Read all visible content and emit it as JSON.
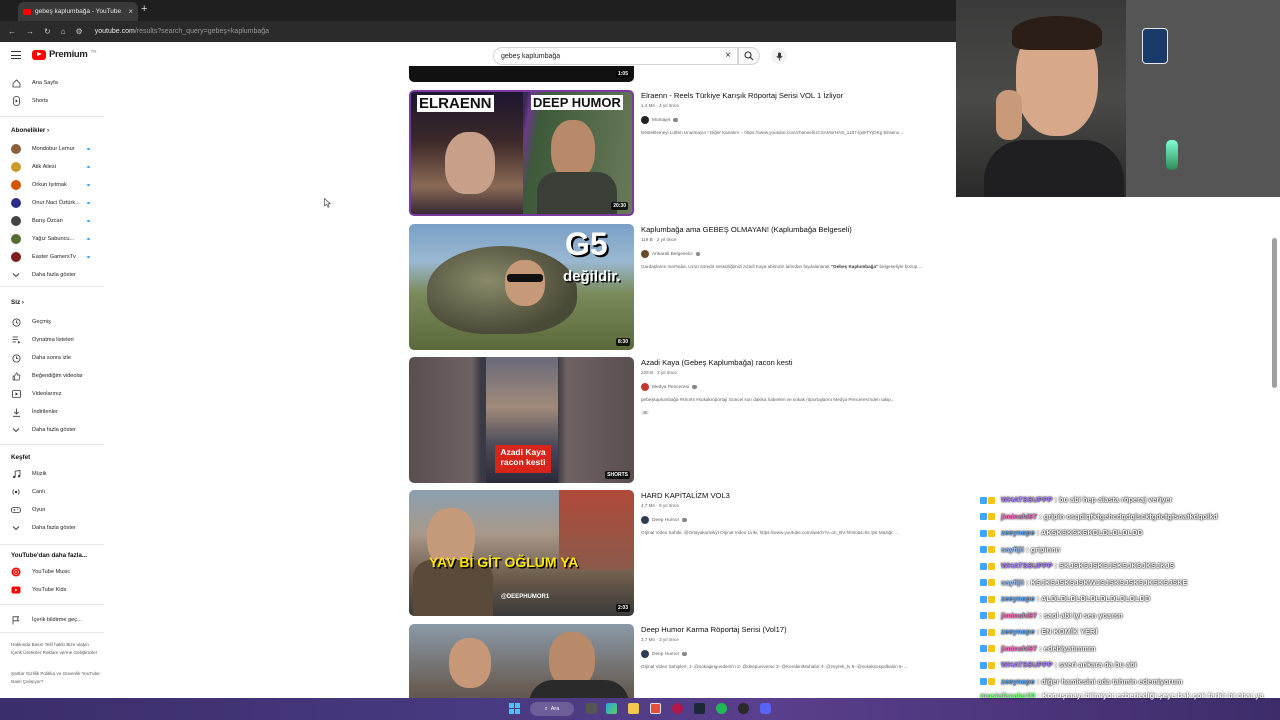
{
  "browser": {
    "tab_title": "gebeş kaplumbağa - YouTube",
    "url_host": "youtube.com",
    "url_path": "/results?search_query=gebeş+kaplumbağa"
  },
  "header": {
    "logo_text": "Premium",
    "logo_region": "TR",
    "search_value": "gebeş kaplumbağa"
  },
  "sidebar": {
    "main": [
      {
        "label": "Ana Sayfa",
        "icon": "home-icon"
      },
      {
        "label": "Shorts",
        "icon": "shorts-icon"
      }
    ],
    "subs_title": "Abonelikler",
    "subs": [
      {
        "label": "Mondobur Lemur",
        "color": "#8b5e3c"
      },
      {
        "label": "Atik Ailesi",
        "color": "#c89b2a"
      },
      {
        "label": "Orkun Işıtmak",
        "color": "#d35400"
      },
      {
        "label": "Onur Naci Öztürk...",
        "color": "#2c2c8a"
      },
      {
        "label": "Barış Özcan",
        "color": "#444444"
      },
      {
        "label": "Yağız Sabuncu...",
        "color": "#556b2f"
      },
      {
        "label": "Easter GamersTv",
        "color": "#7f1d1d"
      }
    ],
    "subs_more": "Daha fazla göster",
    "you_title": "Siz",
    "you": [
      {
        "label": "Geçmiş",
        "icon": "history-icon"
      },
      {
        "label": "Oynatma listeleri",
        "icon": "playlist-icon"
      },
      {
        "label": "Daha sonra izle",
        "icon": "watch-later-icon"
      },
      {
        "label": "Beğendiğim videolar",
        "icon": "like-icon"
      },
      {
        "label": "Videolarınız",
        "icon": "your-videos-icon"
      },
      {
        "label": "İndirilenler",
        "icon": "download-icon"
      },
      {
        "label": "Daha fazla göster",
        "icon": "chevron-down-icon"
      }
    ],
    "explore_title": "Keşfet",
    "explore": [
      {
        "label": "Müzik",
        "icon": "music-icon"
      },
      {
        "label": "Canlı",
        "icon": "live-icon"
      },
      {
        "label": "Oyun",
        "icon": "gaming-icon"
      },
      {
        "label": "Daha fazla göster",
        "icon": "chevron-down-icon"
      }
    ],
    "more_title": "YouTube'dan daha fazla...",
    "more": [
      {
        "label": "YouTube Music",
        "icon": "youtube-music-icon"
      },
      {
        "label": "YouTube Kids",
        "icon": "youtube-kids-icon"
      }
    ],
    "report": "İçerik bildirme geç...",
    "footer1": "Hakkında  Basın  Telif hakkı  Bize ulaşın  İçerik Üreticiler  Reklam verme  Geliştiriciler",
    "footer2": "Şartlar  Gizlilik  Politika ve Güvenlik  YouTube Nasıl Çalışıyor?"
  },
  "results": [
    {
      "title": "Elraenn - Reels Türkiye Karışık Röportaj Serisi VOL 1 İzliyor",
      "meta": "1,4 Mn · 4 yıl önce",
      "channel": "Montajet",
      "desc": "Desteklemeyi Lütfen Unutmayın ! Diğer Kanalım :- https://www.youtube.com/channel/UCSAMorHAS_1187-lgWTYjOKg Elraeno ...",
      "duration": "20:30",
      "thumb_left": "ELRAENN",
      "thumb_right": "DEEP HUMOR"
    },
    {
      "title": "Kaplumbağa ama GEBEŞ OLMAYAN! (Kaplumbağa Belgeseli)",
      "meta": "119 B · 2 yıl önce",
      "channel": "Ankarali Belgeselci",
      "desc_pre": "Gardaşlarım merhaba. Uzun süredir sessizliğimizi Azadi Kaya abimizin lafından faydalanarak ",
      "desc_bold": "\"Gebeş Kaplumbağa\"",
      "desc_post": " belgeseliyle bozup ...",
      "duration": "8:30",
      "thumb_big": "G5",
      "thumb_small": "değildir."
    },
    {
      "title": "Azadi Kaya (Gebeş Kaplumbağa) racon kesti",
      "meta": "228 B · 2 yıl önce",
      "channel": "Medya Penceresi",
      "desc": "gebeşkaplumbağa #shorts #sokakroportaji Güncel son dakika haberleri ve sokak röportajlarını Medya Penceresi'nden takip...",
      "badge": "4K",
      "duration": "SHORTS",
      "thumb_caption": "Azadi Kaya racon kesti"
    },
    {
      "title": "HARD KAPİTALİZM VOL3",
      "meta": "4,7 Mn · 5 yıl önce",
      "channel": "Deep Humor",
      "desc": "Orjinal Video Sahibi; @Ortayakarisikyt Orjinal Video Linki; https://www.youtube.com/watch?v=on_BV-hfmlo&t=5s Şiir Müziği; ...",
      "duration": "2:03",
      "thumb_caption": "YAV Bİ GİT OĞLUM YA",
      "thumb_handle": "@DEEPHUMOR1"
    },
    {
      "title": "Deep Humor Karma Röportaj Serisi (Vol17)",
      "meta": "3,7 Mn · 3 yıl önce",
      "channel": "Deep Humor",
      "desc": "Orjinal Video Sahipleri; 1- @sokagingundemi'n 2- @deepuniverse 3- @KerabiniMuhabir 4- @zeyrek_tv 5- @sokaksosyalbasin 6- ...",
      "duration": ""
    }
  ],
  "prev_duration": "1:05",
  "chat": [
    {
      "user": "WHATSSUPPP",
      "color": "#b084ff",
      "msg": "bu abi hep alasta röperaj veriyer"
    },
    {
      "user": "jiminshi97",
      "color": "#ff6ec7",
      "msg": "gripin osqdlqfkfgehcdqdqlsckfgdcfgfsoafkdqolkd"
    },
    {
      "user": "zeeynope",
      "color": "#5aa9ff",
      "msg": "AKSKSKSKSKDLDLDLDLDD"
    },
    {
      "user": "sayfijii",
      "color": "#a0c8ff",
      "msg": "gripinnn"
    },
    {
      "user": "WHATSSUPPP",
      "color": "#b084ff",
      "msg": "SKJSKSJSKSJSKSJKSJKSJKJS"
    },
    {
      "user": "sayfijii",
      "color": "#a0c8ff",
      "msg": "KSJKSJSKSJSKWJSJSKSJSKSJKSKSJSKE"
    },
    {
      "user": "zeeynope",
      "color": "#5aa9ff",
      "msg": "ALDLDLDLDLDLDLDLDLDLDD"
    },
    {
      "user": "jiminshi97",
      "color": "#ff6ec7",
      "msg": "saol abi iyi sen yoarsn"
    },
    {
      "user": "zeeynope",
      "color": "#5aa9ff",
      "msg": "EN KOMİK YERİ"
    },
    {
      "user": "jiminshi97",
      "color": "#ff6ec7",
      "msg": "edebiyatımmm"
    },
    {
      "user": "WHATSSUPPP",
      "color": "#b084ff",
      "msg": "sveri ankara da bu abi"
    },
    {
      "user": "zeeynope",
      "color": "#5aa9ff",
      "msg": "diğer hamlesini ada tahmin edemiyorum"
    }
  ],
  "last_chat": {
    "user": "mustafacalar00",
    "color": "#7cff7c",
    "msg": "Konuşmayı bilmiyor ezberlediği şeye bak çok farklı bi char ya"
  },
  "taskbar": {
    "search_label": "Ara"
  }
}
